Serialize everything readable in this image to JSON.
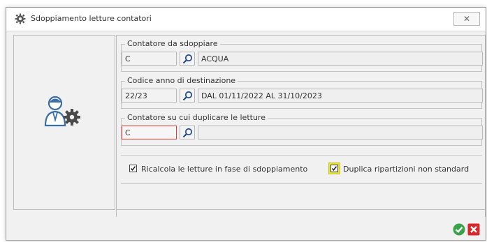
{
  "window": {
    "title": "Sdoppiamento letture contatori",
    "close_glyph": "✕"
  },
  "groups": {
    "source": {
      "legend": "Contatore da sdoppiare",
      "code": "C",
      "description": "ACQUA"
    },
    "year": {
      "legend": "Codice anno di destinazione",
      "code": "22/23",
      "description": "DAL 01/11/2022 AL 31/10/2023"
    },
    "target": {
      "legend": "Contatore su cui duplicare le letture",
      "code": "C",
      "description": ""
    }
  },
  "options": {
    "recalc": {
      "label": "Ricalcola le letture in fase di sdoppiamento",
      "checked": true
    },
    "duplicate": {
      "label": "Duplica ripartizioni non standard",
      "checked": true
    }
  },
  "colors": {
    "ok_green": "#3aa34a",
    "cancel_red": "#d8282b",
    "highlight_yellow": "#e6e23a",
    "error_border": "#e43a3a"
  },
  "icons": {
    "window": "gear-icon",
    "search": "search-icon",
    "panel": "user-gear-icon",
    "ok": "confirm-check-icon",
    "cancel": "cancel-x-icon"
  }
}
